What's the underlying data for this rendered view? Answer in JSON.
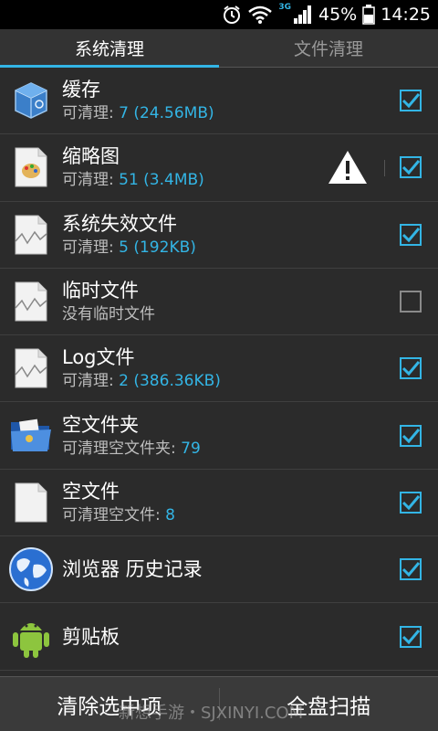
{
  "status_bar": {
    "network": "3G",
    "battery": "45%",
    "time": "14:25",
    "icons": [
      "alarm-icon",
      "wifi-icon",
      "signal-icon",
      "battery-icon"
    ]
  },
  "tabs": [
    {
      "label": "系统清理",
      "active": true
    },
    {
      "label": "文件清理",
      "active": false
    }
  ],
  "items": [
    {
      "title": "缓存",
      "sub_prefix": "可清理: ",
      "sub_value": "7 (24.56MB)",
      "icon": "cache-box-icon",
      "checked": true
    },
    {
      "title": "缩略图",
      "sub_prefix": "可清理: ",
      "sub_value": "51 (3.4MB)",
      "icon": "thumbnail-file-icon",
      "checked": true,
      "warning": true
    },
    {
      "title": "系统失效文件",
      "sub_prefix": "可清理: ",
      "sub_value": "5 (192KB)",
      "icon": "broken-file-icon",
      "checked": true
    },
    {
      "title": "临时文件",
      "sub_prefix": "没有临时文件",
      "sub_value": "",
      "icon": "broken-file-icon",
      "checked": false
    },
    {
      "title": "Log文件",
      "sub_prefix": "可清理: ",
      "sub_value": "2 (386.36KB)",
      "icon": "broken-file-icon",
      "checked": true
    },
    {
      "title": "空文件夹",
      "sub_prefix": "可清理空文件夹: ",
      "sub_value": "79",
      "icon": "folder-icon",
      "checked": true
    },
    {
      "title": "空文件",
      "sub_prefix": "可清理空文件: ",
      "sub_value": "8",
      "icon": "blank-file-icon",
      "checked": true
    },
    {
      "title": "浏览器 历史记录",
      "sub_prefix": "",
      "sub_value": "",
      "icon": "globe-icon",
      "checked": true
    },
    {
      "title": "剪贴板",
      "sub_prefix": "",
      "sub_value": "",
      "icon": "android-icon",
      "checked": true
    }
  ],
  "bottom": {
    "clear_label": "清除选中项",
    "scan_label": "全盘扫描",
    "watermark": "新想手游・SJXINYI.COM"
  },
  "colors": {
    "accent": "#33b5e5",
    "background": "#2b2b2b"
  }
}
